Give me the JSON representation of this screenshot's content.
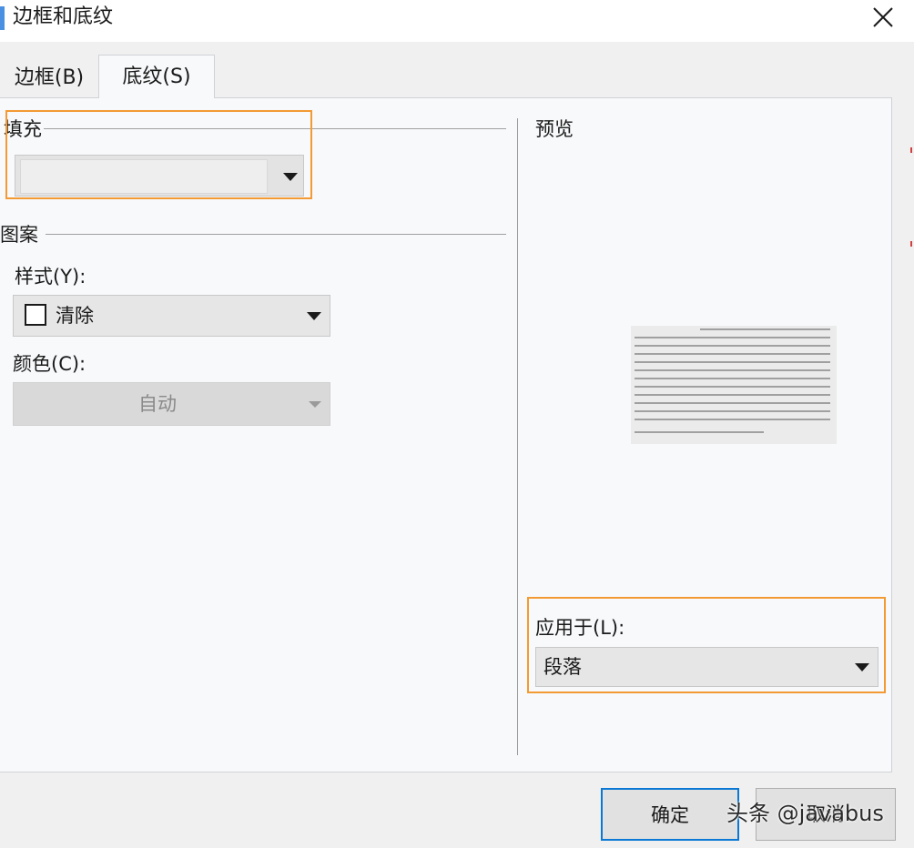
{
  "window": {
    "title": "边框和底纹",
    "close_icon": "close-icon"
  },
  "tabs": [
    {
      "label": "边框(B)",
      "selected": false
    },
    {
      "label": "底纹(S)",
      "selected": true
    }
  ],
  "fill": {
    "group_label": "填充",
    "value": ""
  },
  "pattern": {
    "group_label": "图案",
    "style_label": "样式(Y):",
    "style_value": "清除",
    "color_label": "颜色(C):",
    "color_value": "自动"
  },
  "preview": {
    "label": "预览"
  },
  "apply": {
    "label": "应用于(L):",
    "value": "段落"
  },
  "buttons": {
    "ok": "确定",
    "cancel": "取消"
  },
  "watermark": "头条 @javabus",
  "colors": {
    "highlight": "#f39a33",
    "accent": "#0a78d4"
  }
}
